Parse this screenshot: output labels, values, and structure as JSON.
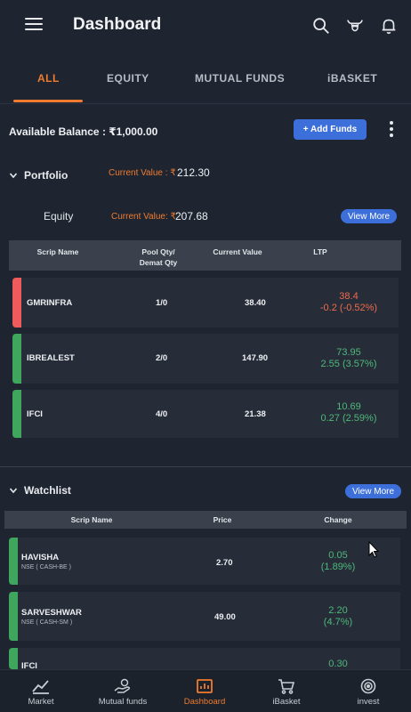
{
  "header": {
    "title": "Dashboard"
  },
  "tabs": [
    {
      "label": "ALL",
      "active": true
    },
    {
      "label": "EQUITY"
    },
    {
      "label": "MUTUAL FUNDS"
    },
    {
      "label": "iBASKET"
    }
  ],
  "balance": {
    "text": "Available Balance : ₹1,000.00",
    "add_funds_label": "+ Add Funds"
  },
  "portfolio": {
    "title": "Portfolio",
    "current_value_label": "Current Value : ₹",
    "current_value": "212.30",
    "equity": {
      "label": "Equity",
      "current_value_label": "Current Value: ₹",
      "current_value": "207.68",
      "view_more_label": "View More"
    },
    "columns": [
      "Scrip Name",
      "Pool Qty/\nDemat Qty",
      "Current Value",
      "LTP"
    ],
    "rows": [
      {
        "name": "GMRINFRA",
        "qty": "1/0",
        "value": "38.40",
        "ltp": "38.4",
        "change": "-0.2 (-0.52%)",
        "trend": "down"
      },
      {
        "name": "IBREALEST",
        "qty": "2/0",
        "value": "147.90",
        "ltp": "73.95",
        "change": "2.55 (3.57%)",
        "trend": "up"
      },
      {
        "name": "IFCI",
        "qty": "4/0",
        "value": "21.38",
        "ltp": "10.69",
        "change": "0.27 (2.59%)",
        "trend": "up"
      }
    ]
  },
  "watchlist": {
    "title": "Watchlist",
    "view_more_label": "View More",
    "columns": [
      "Scrip Name",
      "Price",
      "Change"
    ],
    "rows": [
      {
        "name": "HAVISHA",
        "exchange": "NSE ( CASH-BE )",
        "price": "2.70",
        "change": "0.05",
        "change_pct": "(1.89%)"
      },
      {
        "name": "SARVESHWAR",
        "exchange": "NSE ( CASH-SM )",
        "price": "49.00",
        "change": "2.20",
        "change_pct": "(4.7%)"
      },
      {
        "name": "IFCI",
        "exchange": "",
        "price": "",
        "change": "0.30",
        "change_pct": ""
      }
    ]
  },
  "bottom_nav": [
    {
      "label": "Market",
      "icon": "chart-line-icon"
    },
    {
      "label": "Mutual funds",
      "icon": "hand-money-icon"
    },
    {
      "label": "Dashboard",
      "icon": "bar-chart-icon",
      "active": true
    },
    {
      "label": "iBasket",
      "icon": "cart-icon"
    },
    {
      "label": "invest",
      "icon": "target-icon"
    }
  ],
  "colors": {
    "accent": "#f07b2f",
    "primary_button": "#3d6fdb",
    "gain": "#4fb87a",
    "loss": "#ef6a4e",
    "background": "#1e2530"
  }
}
